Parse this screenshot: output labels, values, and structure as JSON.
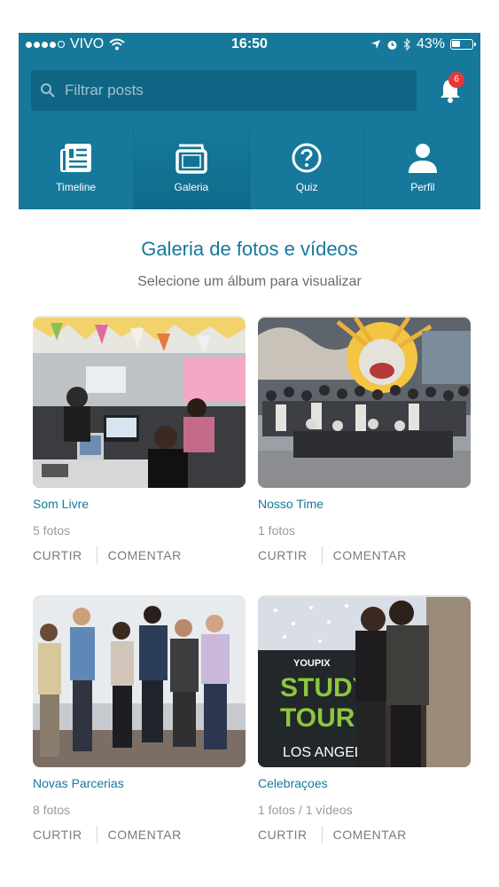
{
  "status_bar": {
    "carrier": "VIVO",
    "time": "16:50",
    "battery": "43%",
    "battery_level": 0.43
  },
  "header": {
    "search_placeholder": "Filtrar posts",
    "notification_count": "6",
    "tabs": [
      {
        "label": "Timeline",
        "icon": "newspaper-icon",
        "active": false
      },
      {
        "label": "Galeria",
        "icon": "gallery-icon",
        "active": true
      },
      {
        "label": "Quiz",
        "icon": "question-icon",
        "active": false
      },
      {
        "label": "Perfil",
        "icon": "person-icon",
        "active": false
      }
    ]
  },
  "page": {
    "title": "Galeria de fotos e vídeos",
    "subtitle": "Selecione um álbum para visualizar"
  },
  "albums": [
    {
      "name": "Som Livre",
      "count": "5 fotos",
      "like": "CURTIR",
      "comment": "COMENTAR"
    },
    {
      "name": "Nosso Time",
      "count": "1 fotos",
      "like": "CURTIR",
      "comment": "COMENTAR"
    },
    {
      "name": "Novas Parcerias",
      "count": "8 fotos",
      "like": "CURTIR",
      "comment": "COMENTAR"
    },
    {
      "name": "Celebraçoes",
      "count": "1 fotos / 1 vídeos",
      "like": "CURTIR",
      "comment": "COMENTAR",
      "photo_text": {
        "brand": "YOUPIX",
        "line1": "STUDY",
        "line2": "TOUR",
        "line3": "LOS ANGELES"
      }
    }
  ],
  "colors": {
    "brand": "#16799b",
    "badge": "#e53935"
  }
}
